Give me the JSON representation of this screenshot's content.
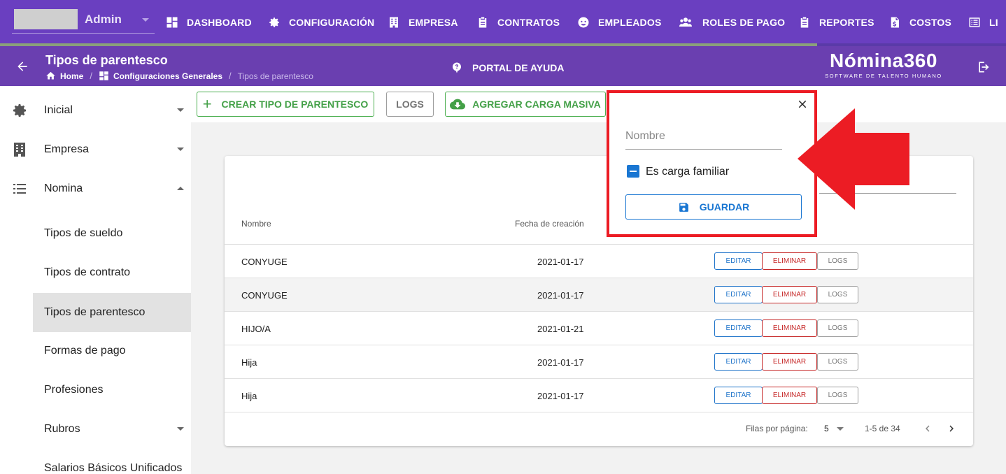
{
  "topnav": {
    "user_name": "Admin",
    "items": [
      {
        "label": "DASHBOARD",
        "icon": "dashboard-icon"
      },
      {
        "label": "CONFIGURACIÓN",
        "icon": "gear-icon"
      },
      {
        "label": "EMPRESA",
        "icon": "building-icon"
      },
      {
        "label": "CONTRATOS",
        "icon": "clipboard-icon"
      },
      {
        "label": "EMPLEADOS",
        "icon": "face-icon"
      },
      {
        "label": "ROLES DE PAGO",
        "icon": "users-icon"
      },
      {
        "label": "REPORTES",
        "icon": "clipboard-icon"
      },
      {
        "label": "COSTOS",
        "icon": "file-dollar-icon"
      },
      {
        "label": "LI",
        "icon": "list-icon"
      }
    ]
  },
  "header": {
    "title": "Tipos de parentesco",
    "breadcrumb": [
      "Home",
      "Configuraciones Generales",
      "Tipos de parentesco"
    ],
    "help_label": "PORTAL DE AYUDA",
    "brand_name": "Nómina360",
    "brand_sub": "SOFTWARE DE TALENTO HUMANO"
  },
  "sidebar": {
    "items": [
      {
        "label": "Inicial"
      },
      {
        "label": "Empresa"
      },
      {
        "label": "Nomina"
      },
      {
        "label": "Tipos de sueldo"
      },
      {
        "label": "Tipos de contrato"
      },
      {
        "label": "Tipos de parentesco"
      },
      {
        "label": "Formas de pago"
      },
      {
        "label": "Profesiones"
      },
      {
        "label": "Rubros"
      },
      {
        "label": "Salarios Básicos Unificados"
      }
    ]
  },
  "toolbar": {
    "create_label": "CREAR TIPO DE PARENTESCO",
    "logs_label": "LOGS",
    "bulk_label": "AGREGAR CARGA MASIVA"
  },
  "table": {
    "headers": [
      "Nombre",
      "Fecha de creación"
    ],
    "rows": [
      {
        "name": "CONYUGE",
        "date": "2021-01-17"
      },
      {
        "name": "CONYUGE",
        "date": "2021-01-17"
      },
      {
        "name": "HIJO/A",
        "date": "2021-01-21"
      },
      {
        "name": "Hija",
        "date": "2021-01-17"
      },
      {
        "name": "Hija",
        "date": "2021-01-17"
      }
    ],
    "edit_label": "EDITAR",
    "delete_label": "ELIMINAR",
    "logs_label": "LOGS",
    "rows_per_page_label": "Filas por página:",
    "rows_per_page": "5",
    "range": "1-5 de 34"
  },
  "dialog": {
    "name_placeholder": "Nombre",
    "checkbox_label": "Es carga familiar",
    "checkbox_state": "indeterminate",
    "save_label": "GUARDAR"
  },
  "colors": {
    "nav": "#6a3fc0",
    "header": "#6a3fb0",
    "primary": "#1976d2",
    "green": "#43a047",
    "highlight": "#ec1c24"
  }
}
